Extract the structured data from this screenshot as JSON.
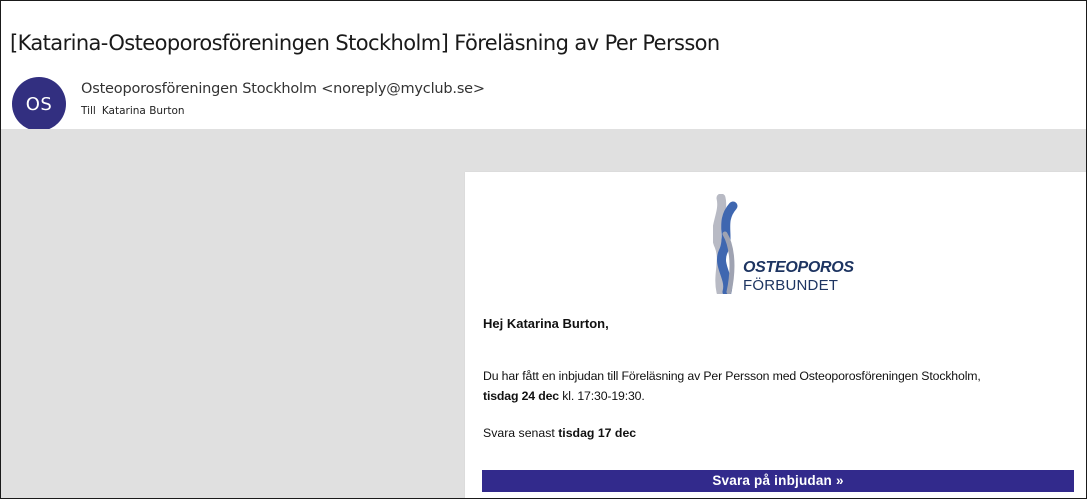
{
  "email": {
    "subject": "[Katarina-Osteoporosföreningen Stockholm] Föreläsning av Per Persson",
    "sender": {
      "initials": "OS",
      "display": "Osteoporosföreningen Stockholm <noreply@myclub.se>",
      "avatar_color": "#322f80"
    },
    "to_label": "Till",
    "to_name": "Katarina Burton"
  },
  "body": {
    "logo": {
      "title": "OSTEOPOROS",
      "subtitle": "FÖRBUNDET"
    },
    "greeting": "Hej Katarina Burton,",
    "invite_text": "Du har fått en inbjudan till Föreläsning av Per Persson med Osteoporosföreningen Stockholm,",
    "event_date": "tisdag 24 dec",
    "time_text": "kl. 17:30-19:30.",
    "reply_prefix": "Svara senast",
    "reply_deadline": "tisdag 17 dec",
    "cta_label": "Svara på inbjudan »",
    "cta_color": "#322a8c"
  }
}
